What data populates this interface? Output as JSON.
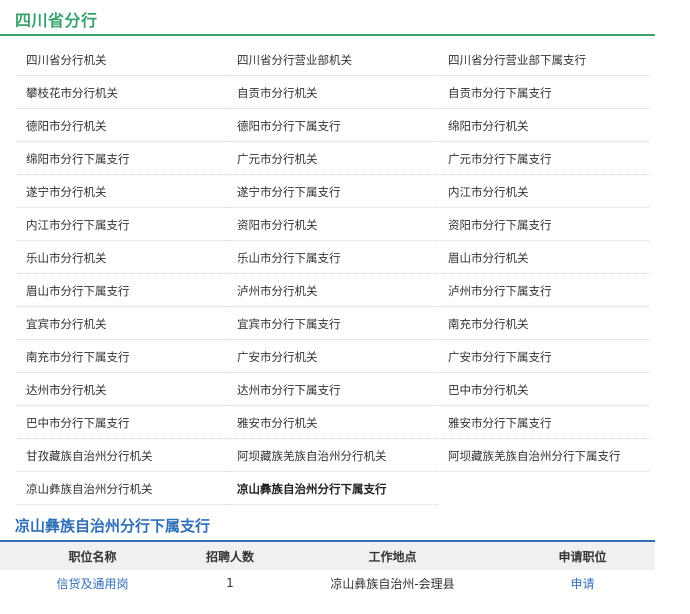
{
  "section": {
    "title": "四川省分行"
  },
  "branches": [
    [
      "四川省分行机关",
      "四川省分行营业部机关",
      "四川省分行营业部下属支行"
    ],
    [
      "攀枝花市分行机关",
      "自贡市分行机关",
      "自贡市分行下属支行"
    ],
    [
      "德阳市分行机关",
      "德阳市分行下属支行",
      "绵阳市分行机关"
    ],
    [
      "绵阳市分行下属支行",
      "广元市分行机关",
      "广元市分行下属支行"
    ],
    [
      "遂宁市分行机关",
      "遂宁市分行下属支行",
      "内江市分行机关"
    ],
    [
      "内江市分行下属支行",
      "资阳市分行机关",
      "资阳市分行下属支行"
    ],
    [
      "乐山市分行机关",
      "乐山市分行下属支行",
      "眉山市分行机关"
    ],
    [
      "眉山市分行下属支行",
      "泸州市分行机关",
      "泸州市分行下属支行"
    ],
    [
      "宜宾市分行机关",
      "宜宾市分行下属支行",
      "南充市分行机关"
    ],
    [
      "南充市分行下属支行",
      "广安市分行机关",
      "广安市分行下属支行"
    ],
    [
      "达州市分行机关",
      "达州市分行下属支行",
      "巴中市分行机关"
    ],
    [
      "巴中市分行下属支行",
      "雅安市分行机关",
      "雅安市分行下属支行"
    ],
    [
      "甘孜藏族自治州分行机关",
      "阿坝藏族羌族自治州分行机关",
      "阿坝藏族羌族自治州分行下属支行"
    ],
    [
      "凉山彝族自治州分行机关",
      "凉山彝族自治州分行下属支行",
      ""
    ]
  ],
  "active_branch": "凉山彝族自治州分行下属支行",
  "detail": {
    "title": "凉山彝族自治州分行下属支行",
    "columns": [
      "职位名称",
      "招聘人数",
      "工作地点",
      "申请职位"
    ],
    "rows": [
      {
        "position": "信贷及通用岗",
        "count": "1",
        "location": "凉山彝族自治州-会理县",
        "apply": "申请"
      }
    ]
  }
}
